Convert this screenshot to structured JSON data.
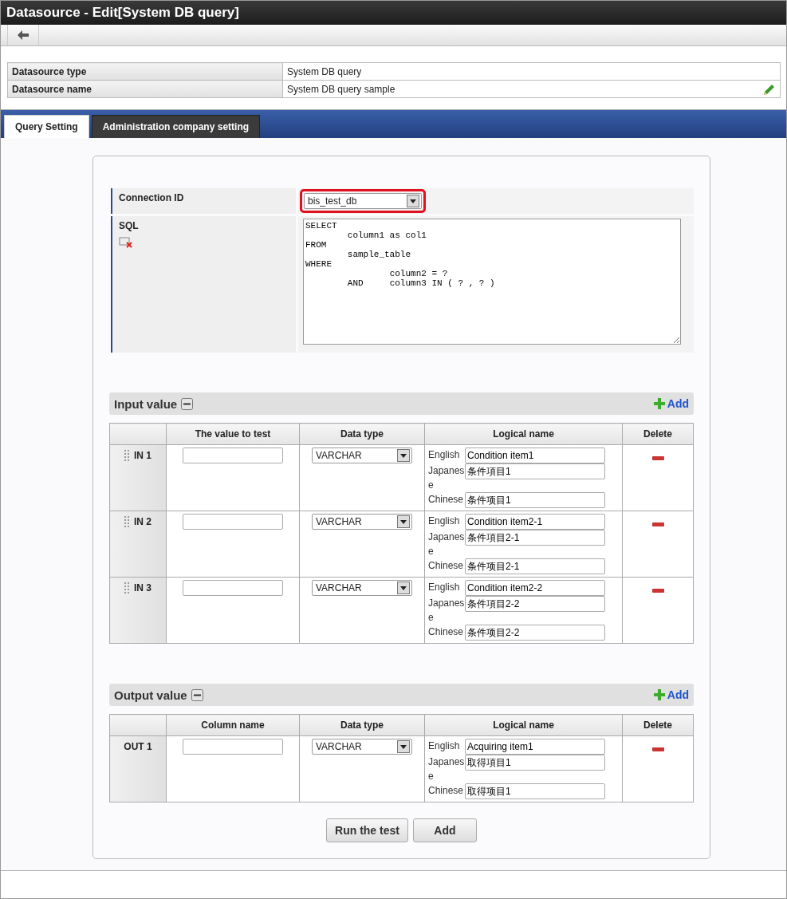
{
  "window": {
    "title": "Datasource - Edit[System DB query]"
  },
  "info": [
    {
      "label": "Datasource type",
      "value": "System DB query",
      "editable": false
    },
    {
      "label": "Datasource name",
      "value": "System DB query sample",
      "editable": true
    }
  ],
  "tabs": [
    {
      "label": "Query Setting",
      "selected": true
    },
    {
      "label": "Administration company setting",
      "selected": false
    }
  ],
  "connection": {
    "label": "Connection ID",
    "value": "bis_test_db",
    "highlighted": true
  },
  "sql": {
    "label": "SQL",
    "value": "SELECT\n\tcolumn1 as col1\nFROM\n\tsample_table\nWHERE\n\t\tcolumn2 = ?\n\tAND\tcolumn3 IN ( ? , ? )"
  },
  "sections": [
    {
      "title": "Input value",
      "add_label": "Add",
      "columns": [
        "",
        "The value to test",
        "Data type",
        "Logical name",
        "Delete"
      ],
      "rows": [
        {
          "id": "IN 1",
          "draggable": true,
          "value": "",
          "data_type": "VARCHAR",
          "names": [
            {
              "lang": "English",
              "value": "Condition item1"
            },
            {
              "lang": "Japanese",
              "value": "条件項目1"
            },
            {
              "lang": "Chinese",
              "value": "条件项目1"
            }
          ]
        },
        {
          "id": "IN 2",
          "draggable": true,
          "value": "",
          "data_type": "VARCHAR",
          "names": [
            {
              "lang": "English",
              "value": "Condition item2-1"
            },
            {
              "lang": "Japanese",
              "value": "条件項目2-1"
            },
            {
              "lang": "Chinese",
              "value": "条件项目2-1"
            }
          ]
        },
        {
          "id": "IN 3",
          "draggable": true,
          "value": "",
          "data_type": "VARCHAR",
          "names": [
            {
              "lang": "English",
              "value": "Condition item2-2"
            },
            {
              "lang": "Japanese",
              "value": "条件項目2-2"
            },
            {
              "lang": "Chinese",
              "value": "条件项目2-2"
            }
          ]
        }
      ]
    },
    {
      "title": "Output value",
      "add_label": "Add",
      "columns": [
        "",
        "Column name",
        "Data type",
        "Logical name",
        "Delete"
      ],
      "rows": [
        {
          "id": "OUT 1",
          "draggable": false,
          "value": "",
          "data_type": "VARCHAR",
          "names": [
            {
              "lang": "English",
              "value": "Acquiring item1"
            },
            {
              "lang": "Japanese",
              "value": "取得項目1"
            },
            {
              "lang": "Chinese",
              "value": "取得项目1"
            }
          ]
        }
      ]
    }
  ],
  "buttons": [
    "Run the test",
    "Add"
  ]
}
